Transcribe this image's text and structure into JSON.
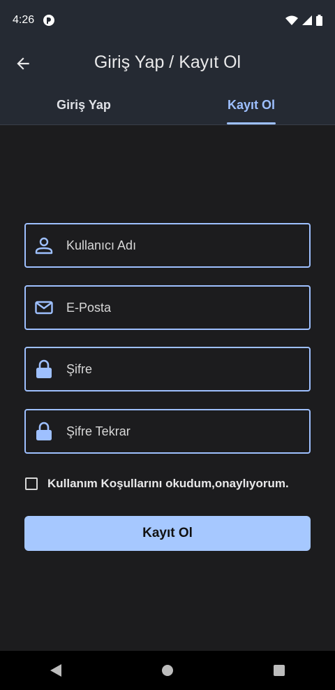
{
  "status_bar": {
    "time": "4:26"
  },
  "app_bar": {
    "title": "Giriş Yap / Kayıt Ol"
  },
  "tabs": [
    {
      "label": "Giriş Yap",
      "active": false
    },
    {
      "label": "Kayıt Ol",
      "active": true
    }
  ],
  "form": {
    "username": {
      "placeholder": "Kullanıcı Adı",
      "icon": "person-icon"
    },
    "email": {
      "placeholder": "E-Posta",
      "icon": "mail-icon"
    },
    "password": {
      "placeholder": "Şifre",
      "icon": "lock-icon"
    },
    "password_repeat": {
      "placeholder": "Şifre Tekrar",
      "icon": "lock-icon"
    },
    "terms_label": "Kullanım Koşullarını okudum,onaylıyorum.",
    "terms_checked": false,
    "submit_label": "Kayıt Ol"
  },
  "colors": {
    "accent": "#9ec0ff",
    "button": "#a6c8ff",
    "bar": "#252a33",
    "background": "#1c1c1e"
  }
}
